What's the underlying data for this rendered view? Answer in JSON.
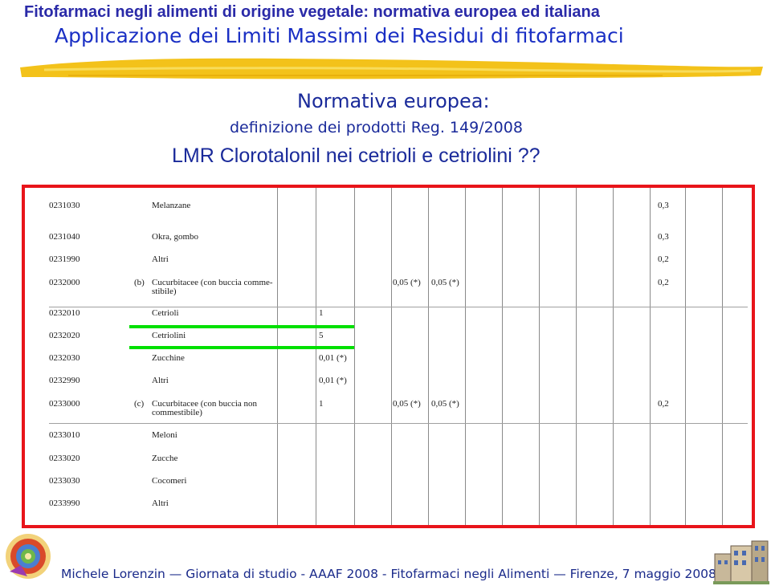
{
  "header": {
    "title": "Fitofarmaci negli alimenti di origine vegetale: normativa europea ed italiana",
    "subtitle": "Applicazione dei Limiti Massimi dei Residui di fitofarmaci"
  },
  "section": {
    "heading": "Normativa europea:",
    "subheading": "definizione dei prodotti Reg. 149/2008",
    "question": "LMR Clorotalonil nei cetrioli e cetriolini ??"
  },
  "table": {
    "rows": [
      {
        "code": "0231030",
        "group": "",
        "name": "Melanzane",
        "lmr1": "",
        "lmr2": "",
        "lmr3": "",
        "last": "0,3"
      },
      {
        "code": "0231040",
        "group": "",
        "name": "Okra, gombo",
        "lmr1": "",
        "lmr2": "",
        "lmr3": "",
        "last": "0,3"
      },
      {
        "code": "0231990",
        "group": "",
        "name": "Altri",
        "lmr1": "",
        "lmr2": "",
        "lmr3": "",
        "last": "0,2"
      },
      {
        "code": "0232000",
        "group": "(b)",
        "name": "Cucurbitacee (con buccia commestibile)",
        "lmr1": "",
        "lmr2": "0,05 (*)",
        "lmr3": "0,05 (*)",
        "last": "0,2"
      },
      {
        "code": "0232010",
        "group": "",
        "name": "Cetrioli",
        "lmr1": "1",
        "lmr2": "",
        "lmr3": "",
        "last": ""
      },
      {
        "code": "0232020",
        "group": "",
        "name": "Cetriolini",
        "lmr1": "5",
        "lmr2": "",
        "lmr3": "",
        "last": ""
      },
      {
        "code": "0232030",
        "group": "",
        "name": "Zucchine",
        "lmr1": "0,01 (*)",
        "lmr2": "",
        "lmr3": "",
        "last": ""
      },
      {
        "code": "0232990",
        "group": "",
        "name": "Altri",
        "lmr1": "0,01 (*)",
        "lmr2": "",
        "lmr3": "",
        "last": ""
      },
      {
        "code": "0233000",
        "group": "(c)",
        "name": "Cucurbitacee (con buccia non commestibile)",
        "lmr1": "1",
        "lmr2": "0,05 (*)",
        "lmr3": "0,05 (*)",
        "last": "0,2"
      },
      {
        "code": "0233010",
        "group": "",
        "name": "Meloni",
        "lmr1": "",
        "lmr2": "",
        "lmr3": "",
        "last": ""
      },
      {
        "code": "0233020",
        "group": "",
        "name": "Zucche",
        "lmr1": "",
        "lmr2": "",
        "lmr3": "",
        "last": ""
      },
      {
        "code": "0233030",
        "group": "",
        "name": "Cocomeri",
        "lmr1": "",
        "lmr2": "",
        "lmr3": "",
        "last": ""
      },
      {
        "code": "0233990",
        "group": "",
        "name": "Altri",
        "lmr1": "",
        "lmr2": "",
        "lmr3": "",
        "last": ""
      }
    ],
    "name_line2": {
      "3": "stibile)",
      "8": "commestibile)"
    },
    "name_line1": {
      "3": "Cucurbitacee (con buccia comme-",
      "8": "Cucurbitacee (con buccia non"
    }
  },
  "footer": {
    "text": "Michele Lorenzin — Giornata di studio - AAAF 2008 - Fitofarmaci negli Alimenti — Firenze, 7 maggio 2008"
  },
  "colors": {
    "title": "#2a2aa8",
    "frame": "#e8141a",
    "highlight": "#00e000",
    "brush": "#f3c21a"
  }
}
